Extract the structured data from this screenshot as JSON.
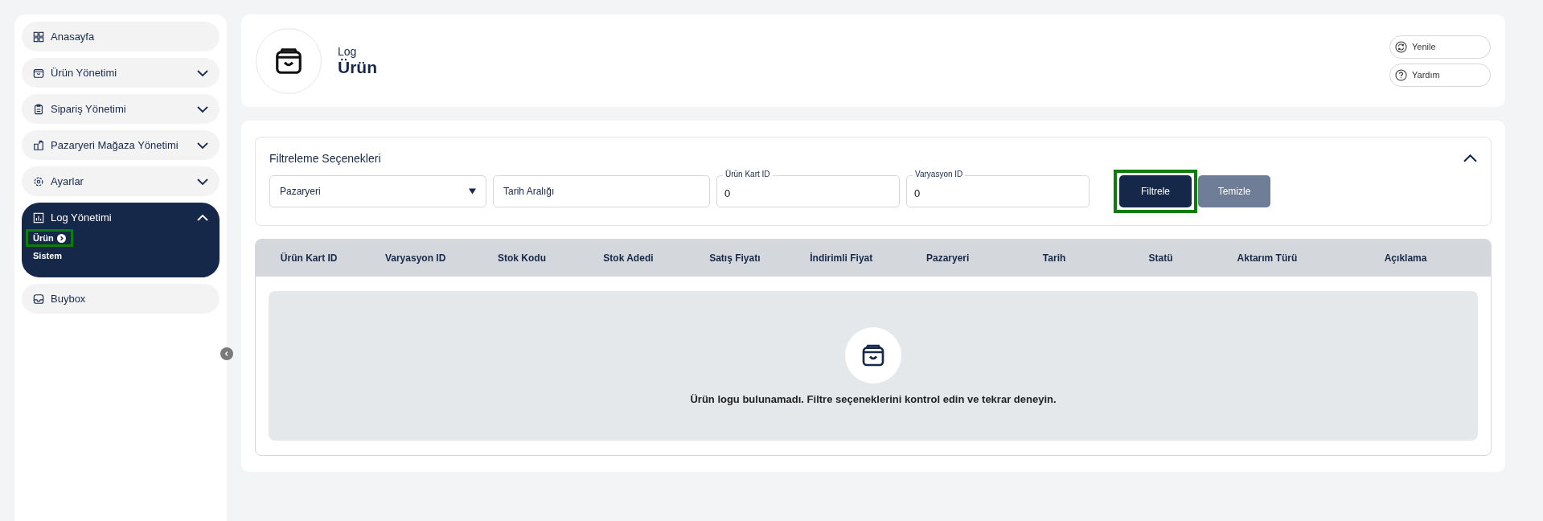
{
  "sidebar": {
    "items": [
      {
        "label": "Anasayfa",
        "selected": false
      },
      {
        "label": "Ürün Yönetimi",
        "expanded": false,
        "selected": false
      },
      {
        "label": "Sipariş Yönetimi",
        "expanded": false,
        "selected": false
      },
      {
        "label": "Pazaryeri Mağaza Yönetimi",
        "expanded": false,
        "selected": false
      },
      {
        "label": "Ayarlar",
        "expanded": false,
        "selected": false
      },
      {
        "label": "Log Yönetimi",
        "expanded": true,
        "selected": true,
        "children": [
          {
            "label": "Ürün",
            "selected": true,
            "highlighted": true
          },
          {
            "label": "Sistem",
            "selected": false,
            "highlighted": false
          }
        ]
      },
      {
        "label": "Buybox",
        "selected": false
      }
    ]
  },
  "header": {
    "subtitle": "Log",
    "title": "Ürün",
    "buttons": [
      {
        "label": "Yenile"
      },
      {
        "label": "Yardım"
      }
    ]
  },
  "filters": {
    "title": "Filtreleme Seçenekleri",
    "expanded": true,
    "fields": [
      {
        "kind": "select",
        "placeholder": "Pazaryeri"
      },
      {
        "kind": "text",
        "placeholder": "Tarih Aralığı"
      },
      {
        "kind": "labeled",
        "label": "Ürün Kart ID",
        "value": "0"
      },
      {
        "kind": "labeled",
        "label": "Varyasyon ID",
        "value": "0"
      }
    ],
    "buttons": [
      {
        "label": "Filtrele",
        "kind": "primary",
        "highlighted": true
      },
      {
        "label": "Temizle",
        "kind": "secondary",
        "highlighted": false
      }
    ]
  },
  "table": {
    "columns": [
      "Ürün Kart ID",
      "Varyasyon ID",
      "Stok Kodu",
      "Stok Adedi",
      "Satış Fiyatı",
      "İndirimli Fiyat",
      "Pazaryeri",
      "Tarih",
      "Statü",
      "Aktarım Türü",
      "Açıklama"
    ],
    "empty_message": "Ürün logu bulunamadı. Filtre seçeneklerini kontrol edin ve tekrar deneyin."
  }
}
